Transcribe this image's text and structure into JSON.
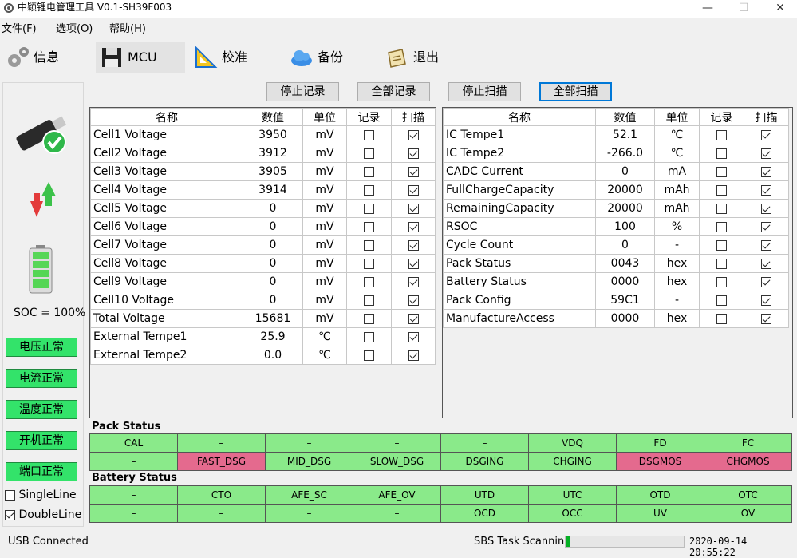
{
  "window": {
    "title": "中颖锂电管理工具 V0.1-SH39F003",
    "minimize": "—",
    "maximize": "☐",
    "close": "✕"
  },
  "menu": [
    "文件(F)",
    "选项(O)",
    "帮助(H)"
  ],
  "toolbar": [
    {
      "label": "信息",
      "icon": "gears-icon"
    },
    {
      "label": "MCU",
      "icon": "floppy-icon"
    },
    {
      "label": "校准",
      "icon": "ruler-icon"
    },
    {
      "label": "备份",
      "icon": "cloud-icon"
    },
    {
      "label": "退出",
      "icon": "exit-icon"
    }
  ],
  "actions": {
    "stop_record": "停止记录",
    "all_record": "全部记录",
    "stop_scan": "停止扫描",
    "all_scan": "全部扫描"
  },
  "left": {
    "soc": "SOC = 100%",
    "statuses": [
      "电压正常",
      "电流正常",
      "温度正常",
      "开机正常",
      "端口正常"
    ],
    "single_line": "SingleLine",
    "double_line": "DoubleLine",
    "single_checked": false,
    "double_checked": true
  },
  "table_headers": {
    "name": "名称",
    "value": "数值",
    "unit": "单位",
    "record": "记录",
    "scan": "扫描"
  },
  "left_table": [
    {
      "name": "Cell1 Voltage",
      "value": "3950",
      "unit": "mV",
      "record": false,
      "scan": true
    },
    {
      "name": "Cell2 Voltage",
      "value": "3912",
      "unit": "mV",
      "record": false,
      "scan": true
    },
    {
      "name": "Cell3 Voltage",
      "value": "3905",
      "unit": "mV",
      "record": false,
      "scan": true
    },
    {
      "name": "Cell4 Voltage",
      "value": "3914",
      "unit": "mV",
      "record": false,
      "scan": true
    },
    {
      "name": "Cell5 Voltage",
      "value": "0",
      "unit": "mV",
      "record": false,
      "scan": true
    },
    {
      "name": "Cell6 Voltage",
      "value": "0",
      "unit": "mV",
      "record": false,
      "scan": true
    },
    {
      "name": "Cell7 Voltage",
      "value": "0",
      "unit": "mV",
      "record": false,
      "scan": true
    },
    {
      "name": "Cell8 Voltage",
      "value": "0",
      "unit": "mV",
      "record": false,
      "scan": true
    },
    {
      "name": "Cell9 Voltage",
      "value": "0",
      "unit": "mV",
      "record": false,
      "scan": true
    },
    {
      "name": "Cell10 Voltage",
      "value": "0",
      "unit": "mV",
      "record": false,
      "scan": true
    },
    {
      "name": "Total Voltage",
      "value": "15681",
      "unit": "mV",
      "record": false,
      "scan": true
    },
    {
      "name": "External Tempe1",
      "value": "25.9",
      "unit": "℃",
      "record": false,
      "scan": true
    },
    {
      "name": "External Tempe2",
      "value": "0.0",
      "unit": "℃",
      "record": false,
      "scan": true
    }
  ],
  "right_table": [
    {
      "name": "IC Tempe1",
      "value": "52.1",
      "unit": "℃",
      "record": false,
      "scan": true
    },
    {
      "name": "IC Tempe2",
      "value": "-266.0",
      "unit": "℃",
      "record": false,
      "scan": true
    },
    {
      "name": "CADC Current",
      "value": "0",
      "unit": "mA",
      "record": false,
      "scan": true
    },
    {
      "name": "FullChargeCapacity",
      "value": "20000",
      "unit": "mAh",
      "record": false,
      "scan": true
    },
    {
      "name": "RemainingCapacity",
      "value": "20000",
      "unit": "mAh",
      "record": false,
      "scan": true
    },
    {
      "name": "RSOC",
      "value": "100",
      "unit": "%",
      "record": false,
      "scan": true
    },
    {
      "name": "Cycle Count",
      "value": "0",
      "unit": "-",
      "record": false,
      "scan": true
    },
    {
      "name": "Pack Status",
      "value": "0043",
      "unit": "hex",
      "record": false,
      "scan": true
    },
    {
      "name": "Battery Status",
      "value": "0000",
      "unit": "hex",
      "record": false,
      "scan": true
    },
    {
      "name": "Pack Config",
      "value": "59C1",
      "unit": "-",
      "record": false,
      "scan": true
    },
    {
      "name": "ManufactureAccess",
      "value": "0000",
      "unit": "hex",
      "record": false,
      "scan": true
    }
  ],
  "pack_status": {
    "title": "Pack Status",
    "rows": [
      [
        {
          "t": "CAL",
          "s": "g"
        },
        {
          "t": "–",
          "s": "g"
        },
        {
          "t": "–",
          "s": "g"
        },
        {
          "t": "–",
          "s": "g"
        },
        {
          "t": "–",
          "s": "g"
        },
        {
          "t": "VDQ",
          "s": "g"
        },
        {
          "t": "FD",
          "s": "g"
        },
        {
          "t": "FC",
          "s": "g"
        }
      ],
      [
        {
          "t": "–",
          "s": "g"
        },
        {
          "t": "FAST_DSG",
          "s": "r"
        },
        {
          "t": "MID_DSG",
          "s": "g"
        },
        {
          "t": "SLOW_DSG",
          "s": "g"
        },
        {
          "t": "DSGING",
          "s": "g"
        },
        {
          "t": "CHGING",
          "s": "g"
        },
        {
          "t": "DSGMOS",
          "s": "r"
        },
        {
          "t": "CHGMOS",
          "s": "r"
        }
      ]
    ]
  },
  "battery_status": {
    "title": "Battery Status",
    "rows": [
      [
        {
          "t": "–",
          "s": "g"
        },
        {
          "t": "CTO",
          "s": "g"
        },
        {
          "t": "AFE_SC",
          "s": "g"
        },
        {
          "t": "AFE_OV",
          "s": "g"
        },
        {
          "t": "UTD",
          "s": "g"
        },
        {
          "t": "UTC",
          "s": "g"
        },
        {
          "t": "OTD",
          "s": "g"
        },
        {
          "t": "OTC",
          "s": "g"
        }
      ],
      [
        {
          "t": "–",
          "s": "g"
        },
        {
          "t": "–",
          "s": "g"
        },
        {
          "t": "–",
          "s": "g"
        },
        {
          "t": "–",
          "s": "g"
        },
        {
          "t": "OCD",
          "s": "g"
        },
        {
          "t": "OCC",
          "s": "g"
        },
        {
          "t": "UV",
          "s": "g"
        },
        {
          "t": "OV",
          "s": "g"
        }
      ]
    ]
  },
  "statusbar": {
    "connection": "USB Connected",
    "task": "SBS Task Scanning",
    "progress": 0.04,
    "datetime": "2020-09-14 20:55:22"
  },
  "colors": {
    "ok_green": "#33e36a",
    "bit_green": "#8aea8a",
    "bit_red": "#e46a8e",
    "progress": "#06b025"
  }
}
